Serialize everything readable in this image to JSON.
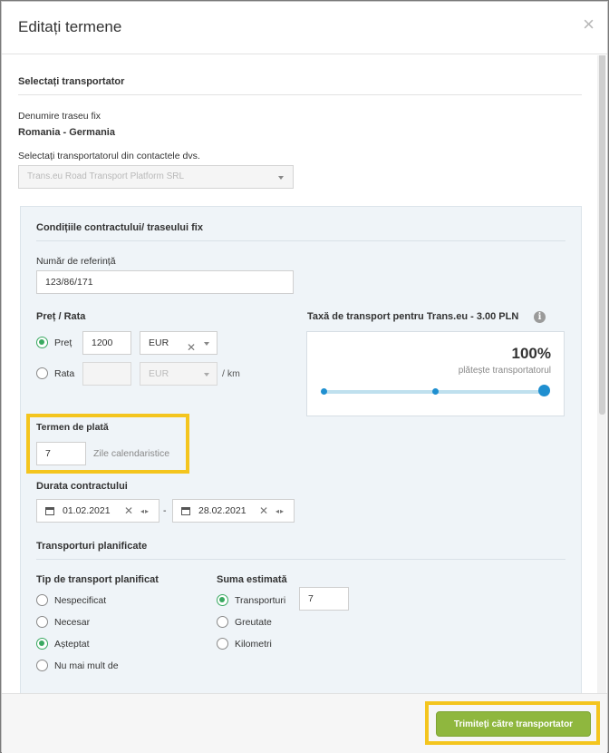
{
  "modal": {
    "title": "Editați termene",
    "close_symbol": "×"
  },
  "carrier": {
    "section_title": "Selectați transportator",
    "route_label": "Denumire traseu fix",
    "route_value": "Romania - Germania",
    "select_label": "Selectați transportatorul din contactele dvs.",
    "select_value": "Trans.eu Road Transport Platform SRL"
  },
  "contract": {
    "section_title": "Condițiile contractului/ traseului fix",
    "reference_label": "Număr de referință",
    "reference_value": "123/86/171",
    "price_heading": "Preț / Rata",
    "price_option": "Preț",
    "price_value": "1200",
    "price_currency": "EUR",
    "rate_option": "Rata",
    "rate_value": "",
    "rate_currency": "EUR",
    "rate_unit": "/ km",
    "price_selected": "price"
  },
  "fee": {
    "label": "Taxă de transport pentru Trans.eu - 3.00 PLN",
    "percent": "100%",
    "payer": "plătește transportatorul",
    "share": 1.0
  },
  "payment_term": {
    "label": "Termen de plată",
    "value": "7",
    "unit": "Zile calendaristice"
  },
  "duration": {
    "label": "Durata contractului",
    "start": "01.02.2021",
    "end": "28.02.2021",
    "separator": "-"
  },
  "planned": {
    "section_title": "Transporturi planificate",
    "type_heading": "Tip de transport planificat",
    "types": [
      {
        "label": "Nespecificat",
        "selected": false
      },
      {
        "label": "Necesar",
        "selected": false
      },
      {
        "label": "Așteptat",
        "selected": true
      },
      {
        "label": "Nu mai mult de",
        "selected": false
      }
    ],
    "amount_heading": "Suma estimată",
    "amounts": [
      {
        "label": "Transporturi",
        "selected": true
      },
      {
        "label": "Greutate",
        "selected": false
      },
      {
        "label": "Kilometri",
        "selected": false
      }
    ],
    "amount_value": "7"
  },
  "footer": {
    "submit_label": "Trimiteți către transportator"
  },
  "colors": {
    "accent_green": "#8fb73e",
    "radio_green": "#3aa961",
    "slider_blue": "#1f8fd0",
    "highlight": "#f4c51e"
  }
}
